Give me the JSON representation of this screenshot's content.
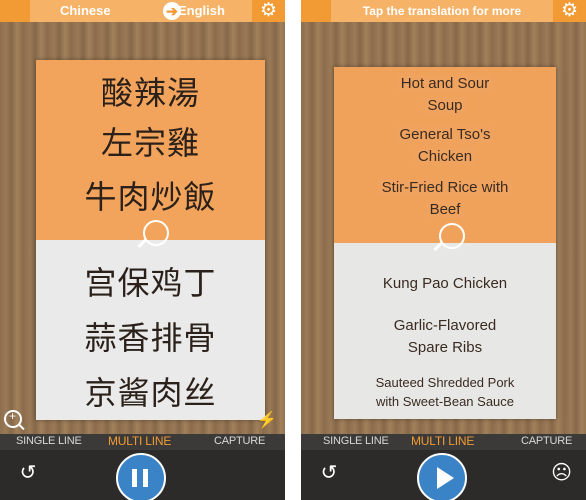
{
  "left": {
    "source_lang": "Chinese",
    "target_lang": "English",
    "arrow_glyph": "➔",
    "menu_zh": [
      "酸辣湯",
      "左宗雞",
      "牛肉炒飯",
      "宫保鸡丁",
      "蒜香排骨",
      "京酱肉丝"
    ],
    "modes": [
      "SINGLE LINE",
      "MULTI LINE",
      "CAPTURE"
    ],
    "active_mode": "MULTI LINE",
    "main_button": "pause"
  },
  "right": {
    "hint": "Tap the translation for more",
    "menu_en": [
      "Hot and Sour Soup",
      "General Tso's Chicken",
      "Stir-Fried Rice with Beef",
      "Kung Pao Chicken",
      "Garlic-Flavored Spare Ribs",
      "Sauteed Shredded Pork with Sweet-Bean Sauce"
    ],
    "menu_en_lines": [
      [
        "Hot and Sour",
        "Soup"
      ],
      [
        "General Tso's",
        "Chicken"
      ],
      [
        "Stir-Fried Rice with",
        "Beef"
      ],
      [
        "Kung Pao Chicken"
      ],
      [
        "Garlic-Flavored",
        "Spare Ribs"
      ],
      [
        "Sauteed Shredded Pork",
        "with Sweet-Bean Sauce"
      ]
    ],
    "modes": [
      "SINGLE LINE",
      "MULTI LINE",
      "CAPTURE"
    ],
    "active_mode": "MULTI LINE",
    "main_button": "play"
  },
  "icons": {
    "gear": "⚙",
    "history": "↺",
    "sad_face": "☹",
    "flash_off": "⚡"
  },
  "colors": {
    "accent_orange": "#f29b34",
    "play_blue": "#3a83c6",
    "bar_dark": "#2c2b2a"
  }
}
